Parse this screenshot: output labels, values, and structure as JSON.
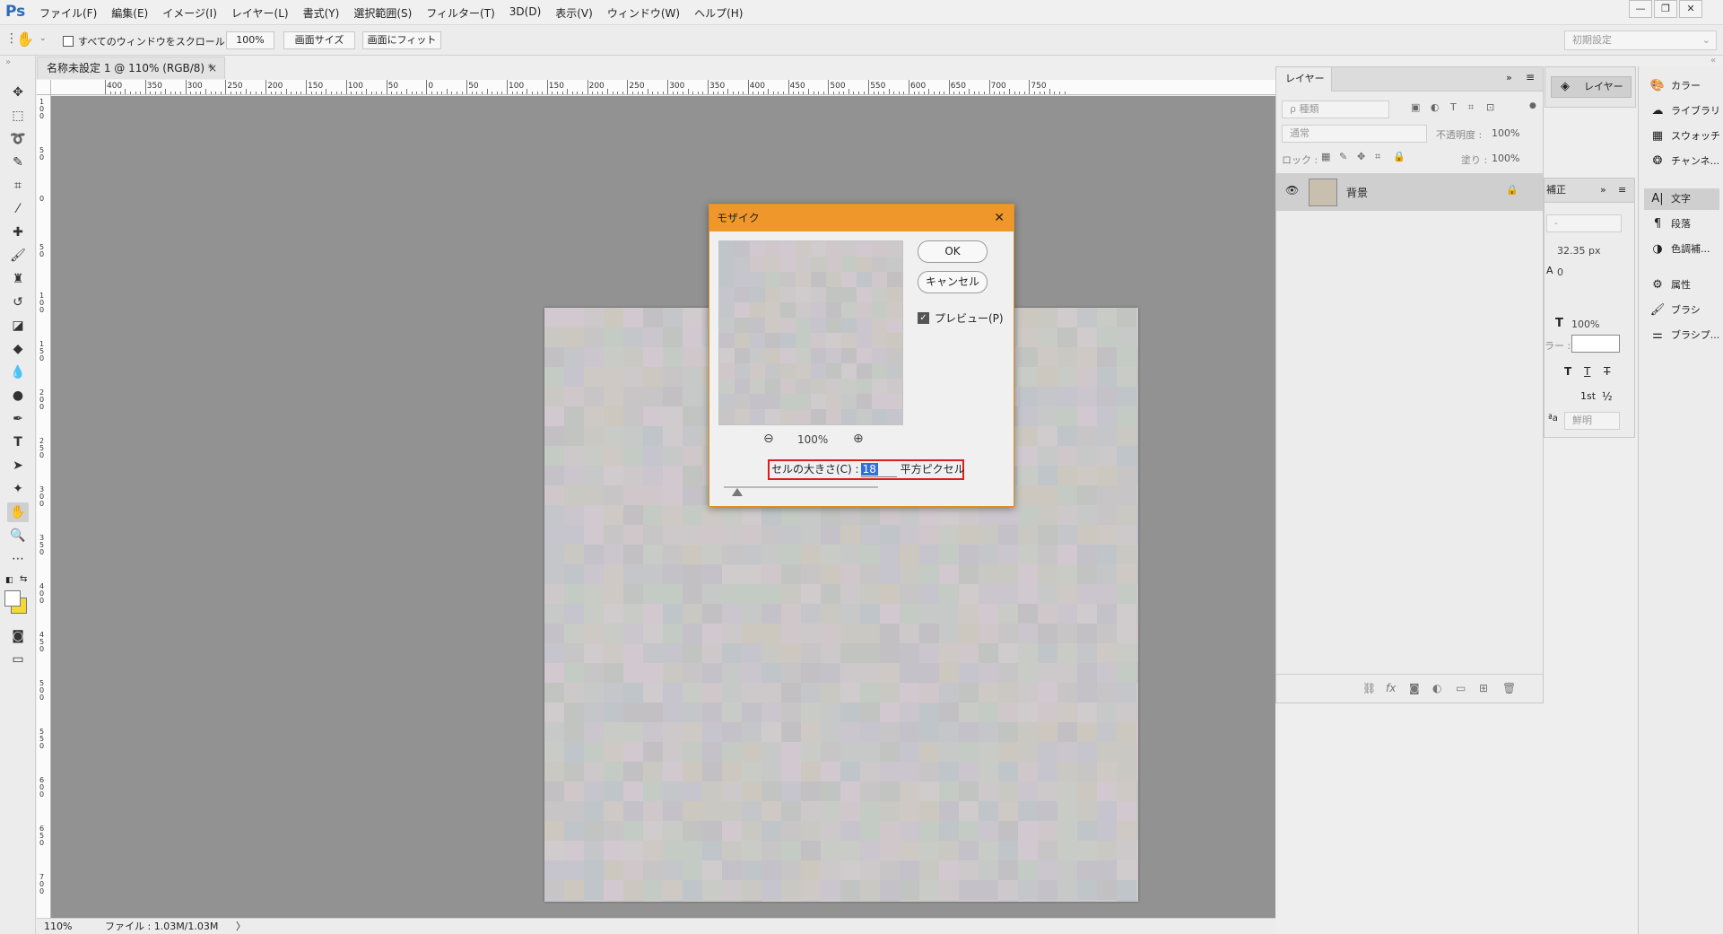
{
  "app": {
    "logo": "Ps",
    "menu": [
      "ファイル(F)",
      "編集(E)",
      "イメージ(I)",
      "レイヤー(L)",
      "書式(Y)",
      "選択範囲(S)",
      "フィルター(T)",
      "3D(D)",
      "表示(V)",
      "ウィンドウ(W)",
      "ヘルプ(H)"
    ],
    "window_controls": {
      "minimize": "—",
      "restore": "❐",
      "close": "✕"
    }
  },
  "options_bar": {
    "scroll_all_label": "すべてのウィンドウをスクロール",
    "zoom_100": "100%",
    "fit_screen_size": "画面サイズ",
    "fit_to_screen": "画面にフィット",
    "workspace": "初期設定"
  },
  "document": {
    "tab_title": "名称未設定 1 @ 110% (RGB/8) *",
    "tab_close": "×",
    "ruler_top_labels": [
      "400",
      "350",
      "300",
      "250",
      "200",
      "150",
      "100",
      "50",
      "0",
      "50",
      "100",
      "150",
      "200",
      "250",
      "300",
      "350",
      "400",
      "450",
      "500",
      "550",
      "600",
      "650",
      "700",
      "750"
    ],
    "ruler_left_labels": [
      "100",
      "50",
      "0",
      "50",
      "100",
      "150",
      "200",
      "250",
      "300",
      "350",
      "400",
      "450",
      "500",
      "550",
      "600",
      "650",
      "700"
    ]
  },
  "status_bar": {
    "zoom": "110%",
    "file_info": "ファイル : 1.03M/1.03M",
    "arrow": "〉"
  },
  "mosaic_dialog": {
    "title": "モザイク",
    "close": "✕",
    "ok_label": "OK",
    "cancel_label": "キャンセル",
    "preview_label": "プレビュー(P)",
    "preview_checked": true,
    "zoom_level": "100%",
    "cell_size_label": "セルの大きさ(C) :",
    "cell_size_value": "18",
    "cell_size_unit": "平方ピクセル"
  },
  "layers_panel": {
    "tab_label": "レイヤー",
    "kind_placeholder": "ρ 種類",
    "blend_mode": "通常",
    "opacity_label": "不透明度 :",
    "opacity_value": "100%",
    "lock_label": "ロック :",
    "fill_label": "塗り :",
    "fill_value": "100%",
    "layers": [
      {
        "name": "背景",
        "visible": true,
        "locked": true,
        "thumb_color": "#c9bfae"
      }
    ],
    "bottom_icons": [
      "link-icon",
      "fx-icon",
      "mask-icon",
      "adjustment-icon",
      "group-icon",
      "new-layer-icon",
      "trash-icon"
    ]
  },
  "character_panel": {
    "tab_label": "補正",
    "font_size": "32.35 px",
    "tracking": "0",
    "vertical_scale": "100%",
    "color_label": "ラー :",
    "antialias": "鮮明",
    "font_style": "-"
  },
  "dock_mid": {
    "layers_button": "レイヤー"
  },
  "dock_right": {
    "items": [
      {
        "label": "カラー",
        "icon": "palette-icon"
      },
      {
        "label": "ライブラリ",
        "icon": "library-icon"
      },
      {
        "label": "スウォッチ",
        "icon": "swatches-icon"
      },
      {
        "label": "チャンネ...",
        "icon": "channels-icon"
      },
      {
        "label": "文字",
        "icon": "character-icon",
        "active": true
      },
      {
        "label": "段落",
        "icon": "paragraph-icon"
      },
      {
        "label": "色調補...",
        "icon": "adjustments-icon"
      },
      {
        "label": "属性",
        "icon": "properties-icon"
      },
      {
        "label": "ブラシ",
        "icon": "brush-icon"
      },
      {
        "label": "ブラシプ...",
        "icon": "brush-preset-icon"
      }
    ]
  },
  "colors": {
    "dialog_title_bar": "#f0972c",
    "highlight_border": "#e01b1b",
    "selection_blue": "#3070d8",
    "canvas_bg": "#929292",
    "foreground_swatch": "#ffffff",
    "background_swatch": "#f5d73a"
  }
}
